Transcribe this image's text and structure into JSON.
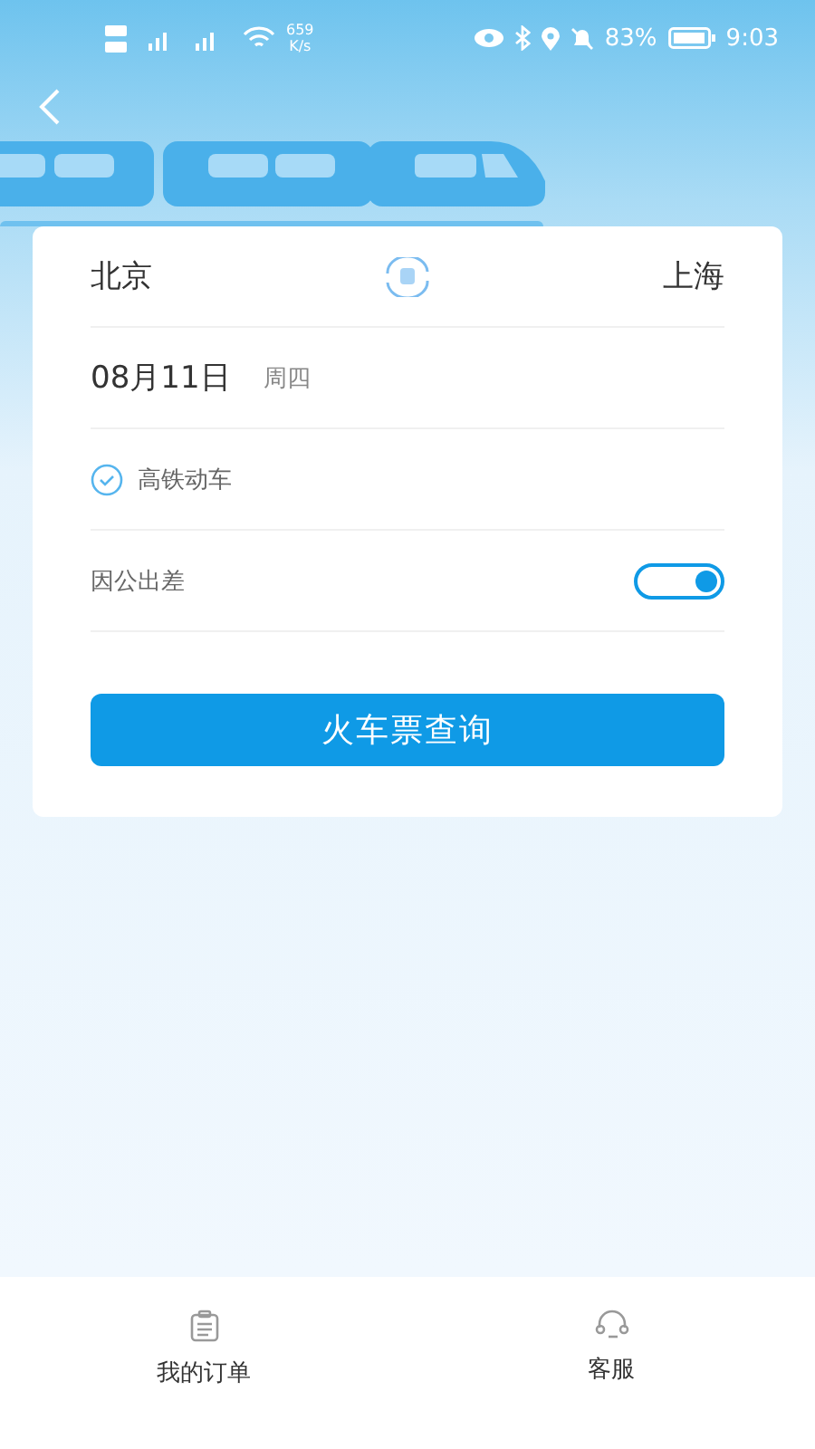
{
  "status_bar": {
    "net_speed": "659",
    "net_unit": "K/s",
    "battery": "83%",
    "time": "9:03"
  },
  "route": {
    "from": "北京",
    "to": "上海"
  },
  "date": {
    "day": "08月11日",
    "weekday": "周四"
  },
  "high_speed_only": {
    "label": "高铁动车",
    "checked": true
  },
  "business_trip": {
    "label": "因公出差",
    "on": true
  },
  "search_button": "火车票查询",
  "bottom_nav": [
    {
      "label": "我的订单"
    },
    {
      "label": "客服"
    }
  ]
}
